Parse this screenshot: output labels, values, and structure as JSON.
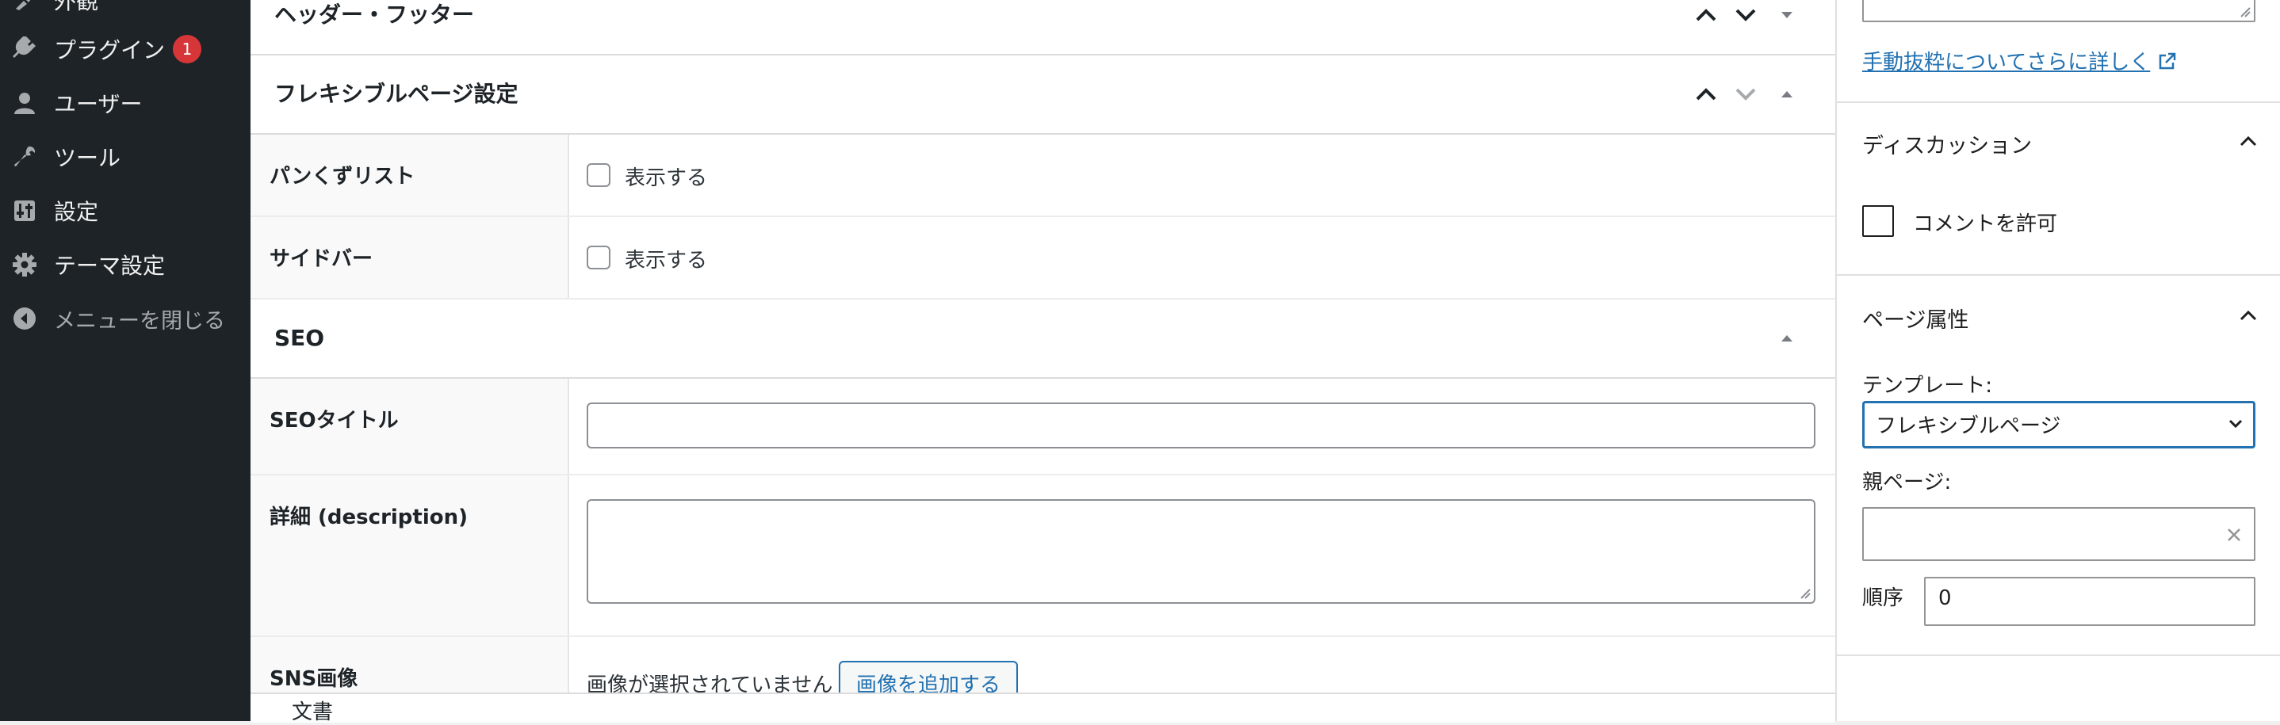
{
  "admin_menu": {
    "items": [
      {
        "icon": "appearance-icon",
        "label": "外観"
      },
      {
        "icon": "plugins-icon",
        "label": "プラグイン",
        "badge": "1"
      },
      {
        "icon": "users-icon",
        "label": "ユーザー"
      },
      {
        "icon": "tools-icon",
        "label": "ツール"
      },
      {
        "icon": "settings-icon",
        "label": "設定"
      },
      {
        "icon": "gear-icon",
        "label": "テーマ設定"
      },
      {
        "icon": "collapse-arrow-icon",
        "label": "メニューを閉じる"
      }
    ]
  },
  "metaboxes": {
    "header_footer": {
      "title": "ヘッダー・フッター"
    },
    "flexible": {
      "title": "フレキシブルページ設定",
      "breadcrumb": {
        "label": "パンくずリスト",
        "checkbox_label": "表示する",
        "checked": false
      },
      "sidebar": {
        "label": "サイドバー",
        "checkbox_label": "表示する",
        "checked": false
      }
    },
    "seo": {
      "title": "SEO",
      "seo_title": {
        "label": "SEOタイトル",
        "value": ""
      },
      "description": {
        "label": "詳細 (description)",
        "value": ""
      },
      "sns_image": {
        "label": "SNS画像",
        "none_text": "画像が選択されていません",
        "add_button": "画像を追加する"
      }
    }
  },
  "footer": {
    "breadcrumb": "文書"
  },
  "settings_sidebar": {
    "excerpt_link": "手動抜粋についてさらに詳しく",
    "discussion": {
      "title": "ディスカッション",
      "allow_comments_label": "コメントを許可",
      "allow_comments": false
    },
    "page_attributes": {
      "title": "ページ属性",
      "template_label": "テンプレート:",
      "template_value": "フレキシブルページ",
      "parent_label": "親ページ:",
      "parent_value": "",
      "order_label": "順序",
      "order_value": "0"
    }
  },
  "colors": {
    "admin_bg": "#1d2327",
    "accent": "#2271b1",
    "badge": "#d63638"
  }
}
